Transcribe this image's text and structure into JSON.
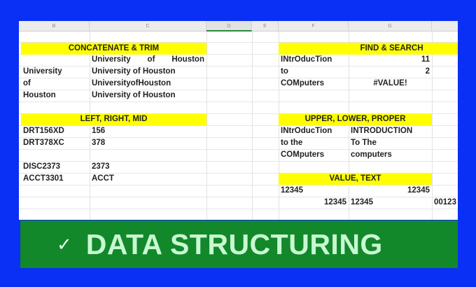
{
  "columns": [
    "B",
    "C",
    "D",
    "E",
    "F",
    "G"
  ],
  "concat": {
    "title": "CONCATENATE & TRIM",
    "c_row1": [
      "University",
      "of",
      "Houston"
    ],
    "b": [
      "University",
      "of",
      "Houston"
    ],
    "c": [
      "University of Houston",
      "UniversityofHouston",
      "University of Houston"
    ]
  },
  "lrm": {
    "title": "LEFT, RIGHT, MID",
    "rows": [
      [
        "DRT156XD",
        "156"
      ],
      [
        "DRT378XC",
        "378"
      ],
      [
        "",
        ""
      ],
      [
        "DISC2373",
        "2373"
      ],
      [
        "ACCT3301",
        "ACCT"
      ]
    ]
  },
  "find": {
    "title": "FIND & SEARCH",
    "rows": [
      [
        "INtrOducTion",
        "11"
      ],
      [
        "to",
        "2"
      ],
      [
        "COMputers",
        "#VALUE!"
      ]
    ]
  },
  "upper": {
    "title": "UPPER, LOWER, PROPER",
    "rows": [
      [
        "INtrOducTion",
        "INTRODUCTION"
      ],
      [
        "to the",
        "To The"
      ],
      [
        "COMputers",
        "computers"
      ]
    ]
  },
  "value": {
    "title": "VALUE, TEXT",
    "row1": [
      "12345",
      "12345"
    ],
    "row2": [
      "12345",
      "12345",
      "00123"
    ]
  },
  "banner": {
    "check": "✓",
    "title": "DATA STRUCTURING"
  }
}
